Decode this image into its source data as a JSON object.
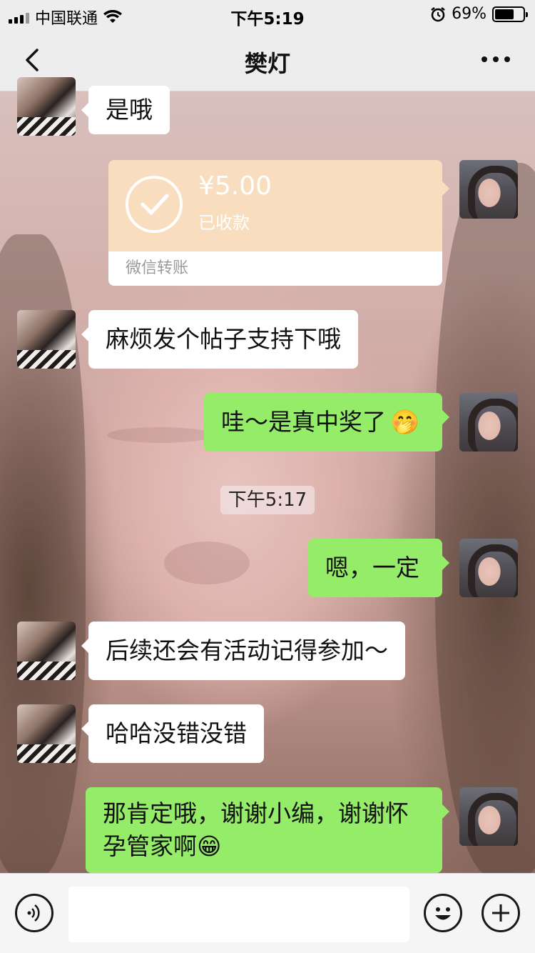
{
  "status_bar": {
    "carrier": "中国联通",
    "time": "下午5:19",
    "battery_percent": "69%",
    "battery_level": 0.69
  },
  "nav": {
    "title": "樊灯",
    "back_icon": "chevron-left-icon",
    "more_icon": "more-dots-icon"
  },
  "messages": [
    {
      "side": "left",
      "text": "是哦"
    },
    {
      "side": "right",
      "type": "transfer",
      "amount": "¥5.00",
      "status": "已收款",
      "label": "微信转账"
    },
    {
      "side": "left",
      "text": "麻烦发个帖子支持下哦"
    },
    {
      "side": "right",
      "text": "哇～是真中奖了",
      "emoji": "🤭"
    },
    {
      "type": "timestamp",
      "text": "下午5:17"
    },
    {
      "side": "right",
      "text": "嗯，一定"
    },
    {
      "side": "left",
      "text": "后续还会有活动记得参加～"
    },
    {
      "side": "left",
      "text": "哈哈没错没错"
    },
    {
      "side": "right",
      "text_line1": "那肯定哦，谢谢小编，谢谢怀",
      "text_line2": "孕管家啊",
      "emoji": "😁"
    }
  ],
  "input_bar": {
    "voice_icon": "voice-icon",
    "emoji_icon": "smiley-icon",
    "plus_icon": "plus-icon",
    "value": ""
  },
  "colors": {
    "green_bubble": "#95ec69",
    "white_bubble": "#ffffff",
    "transfer_card": "#f9ddbf",
    "bar_bg": "#ededed"
  }
}
